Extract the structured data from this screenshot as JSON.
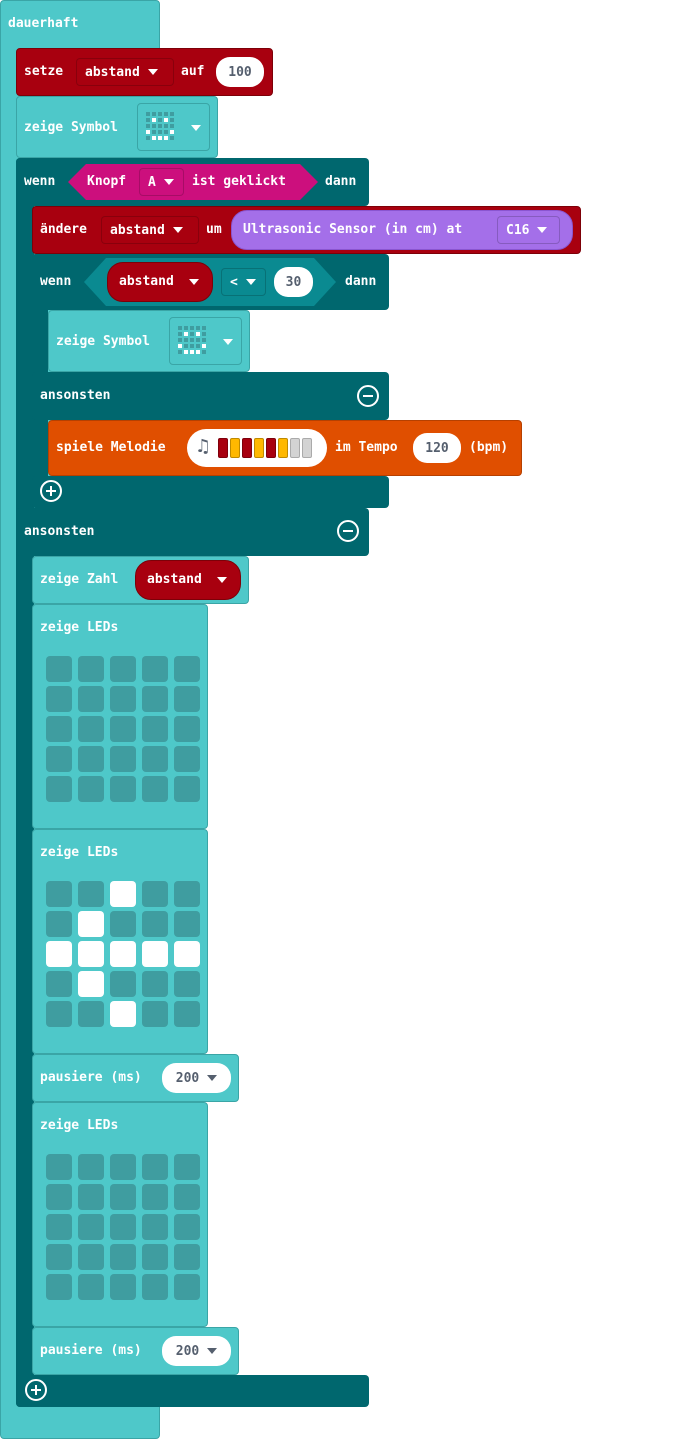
{
  "forever": {
    "label": "dauerhaft"
  },
  "set_block": {
    "keyword": "setze",
    "variable": "abstand",
    "to_label": "auf",
    "value": "100"
  },
  "show_icon_1": {
    "label": "zeige Symbol"
  },
  "if_block": {
    "if_label": "wenn",
    "then_label": "dann",
    "else_label": "ansonsten"
  },
  "button_event": {
    "label": "Knopf",
    "button": "A",
    "suffix": "ist geklickt"
  },
  "change_block": {
    "keyword": "ändere",
    "variable": "abstand",
    "by_label": "um"
  },
  "sonar": {
    "label": "Ultrasonic Sensor (in cm) at",
    "pin": "C16"
  },
  "inner_if": {
    "if_label": "wenn",
    "variable": "abstand",
    "operator": "<",
    "value": "30",
    "then_label": "dann",
    "else_label": "ansonsten"
  },
  "show_icon_2": {
    "label": "zeige Symbol"
  },
  "melody": {
    "keyword": "spiele Melodie",
    "tempo_label": "im Tempo",
    "tempo": "120",
    "unit": "(bpm)",
    "notes": [
      "#a8000f",
      "#ffb800",
      "#a8000f",
      "#ffb800",
      "#a8000f",
      "#ffb800",
      "#d3d3d3",
      "#d3d3d3"
    ]
  },
  "show_number": {
    "label": "zeige Zahl",
    "variable": "abstand"
  },
  "show_leds_1": {
    "label": "zeige LEDs",
    "grid": [
      [
        0,
        0,
        0,
        0,
        0
      ],
      [
        0,
        0,
        0,
        0,
        0
      ],
      [
        0,
        0,
        0,
        0,
        0
      ],
      [
        0,
        0,
        0,
        0,
        0
      ],
      [
        0,
        0,
        0,
        0,
        0
      ]
    ]
  },
  "show_leds_2": {
    "label": "zeige LEDs",
    "grid": [
      [
        0,
        0,
        1,
        0,
        0
      ],
      [
        0,
        1,
        0,
        0,
        0
      ],
      [
        1,
        1,
        1,
        1,
        1
      ],
      [
        0,
        1,
        0,
        0,
        0
      ],
      [
        0,
        0,
        1,
        0,
        0
      ]
    ]
  },
  "pause_1": {
    "label": "pausiere (ms)",
    "value": "200"
  },
  "show_leds_3": {
    "label": "zeige LEDs",
    "grid": [
      [
        0,
        0,
        0,
        0,
        0
      ],
      [
        0,
        0,
        0,
        0,
        0
      ],
      [
        0,
        0,
        0,
        0,
        0
      ],
      [
        0,
        0,
        0,
        0,
        0
      ],
      [
        0,
        0,
        0,
        0,
        0
      ]
    ]
  },
  "pause_2": {
    "label": "pausiere (ms)",
    "value": "200"
  },
  "icons": {
    "symbol_preview": "led-icon-preview",
    "add": "plus-circle-icon",
    "remove": "minus-circle-icon",
    "note": "music-note-icon"
  },
  "colors": {
    "basic": "#4ec8c9",
    "logic": "#00676e",
    "variables": "#a8000f",
    "input": "#cc0f7d",
    "music": "#e04f00",
    "sonar": "#a46fe9"
  }
}
